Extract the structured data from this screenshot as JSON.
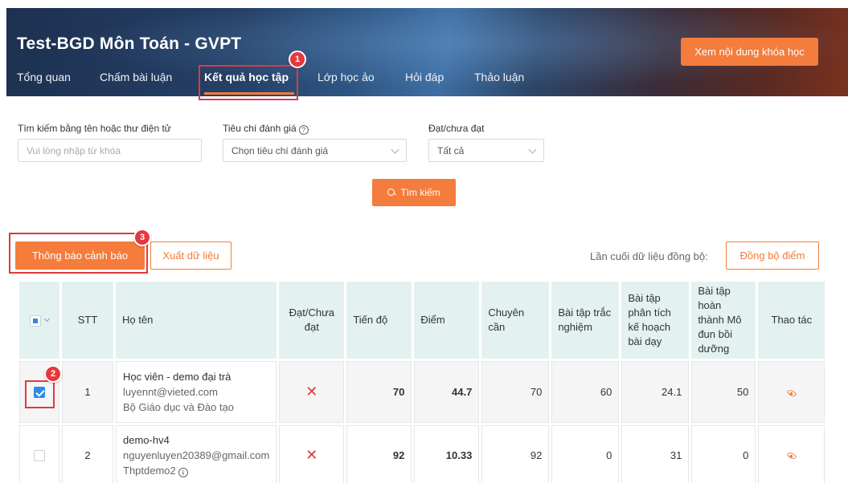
{
  "header": {
    "course_title": "Test-BGD Môn Toán - GVPT",
    "view_content_button": "Xem nội dung khóa học",
    "tabs": [
      {
        "label": "Tổng quan"
      },
      {
        "label": "Chấm bài luận"
      },
      {
        "label": "Kết quả học tập",
        "active": true
      },
      {
        "label": "Lớp học ảo"
      },
      {
        "label": "Hỏi đáp"
      },
      {
        "label": "Thảo luận"
      }
    ]
  },
  "steps": [
    "1",
    "2",
    "3"
  ],
  "filters": {
    "search": {
      "label": "Tìm kiếm bằng tên hoặc thư điện tử",
      "placeholder": "Vui lòng nhập từ khóa"
    },
    "criteria": {
      "label": "Tiêu chí đánh giá",
      "value": "Chọn tiêu chí đánh giá"
    },
    "status": {
      "label": "Đạt/chưa đạt",
      "value": "Tất cả"
    },
    "search_button": "Tìm kiếm"
  },
  "actions": {
    "warning_button": "Thông báo cảnh báo",
    "export_button": "Xuất dữ liệu",
    "sync_label": "Lần cuối dữ liệu đồng bộ:",
    "sync_button": "Đồng bộ điểm"
  },
  "table": {
    "headers": {
      "stt": "STT",
      "name": "Họ tên",
      "pass": "Đạt/Chưa đạt",
      "progress": "Tiến độ",
      "score": "Điểm",
      "attendance": "Chuyên cần",
      "quiz": "Bài tập trắc nghiệm",
      "lesson_plan": "Bài tập phân tích kế hoạch bài dạy",
      "module": "Bài tập hoàn thành Mô đun bồi dưỡng",
      "actions": "Thao tác"
    },
    "rows": [
      {
        "stt": "1",
        "name": "Học viên - demo đại trà",
        "email": "luyennt@vieted.com",
        "org": "Bộ Giáo dục và Đào tạo",
        "pass": "✕",
        "progress": "70",
        "score": "44.7",
        "attendance": "70",
        "quiz": "60",
        "lesson_plan": "24.1",
        "module": "50",
        "checked": true
      },
      {
        "stt": "2",
        "name": "demo-hv4",
        "email": "nguyenluyen20389@gmail.com",
        "org": "Thptdemo2",
        "pass": "✕",
        "progress": "92",
        "score": "10.33",
        "attendance": "92",
        "quiz": "0",
        "lesson_plan": "31",
        "module": "0",
        "checked": false
      }
    ]
  },
  "colors": {
    "accent": "#f47c3c",
    "highlight": "#e0393e",
    "header_bg": "#e3f1f1",
    "positive": "#3a9a3a"
  }
}
